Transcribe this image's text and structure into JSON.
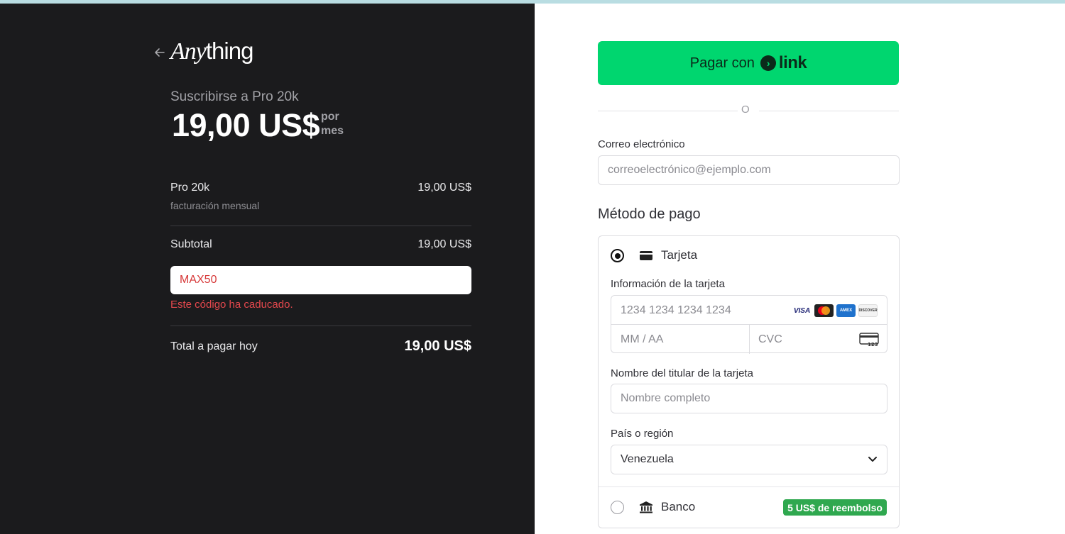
{
  "summary": {
    "brand_any": "Any",
    "brand_thing": "thing",
    "subscribe_title": "Suscribirse a Pro 20k",
    "price": "19,00 US$",
    "period_line1": "por",
    "period_line2": "mes",
    "item_name": "Pro 20k",
    "item_note": "facturación mensual",
    "item_price": "19,00 US$",
    "subtotal_label": "Subtotal",
    "subtotal_value": "19,00 US$",
    "coupon_value": "MAX50",
    "coupon_error": "Este código ha caducado.",
    "total_label": "Total a pagar hoy",
    "total_value": "19,00 US$"
  },
  "checkout": {
    "link_button_prefix": "Pagar con",
    "link_logo_text": "link",
    "or_text": "O",
    "email_label": "Correo electrónico",
    "email_placeholder": "correoelectrónico@ejemplo.com",
    "payment_method_title": "Método de pago",
    "card_option_label": "Tarjeta",
    "card_info_label": "Información de la tarjeta",
    "card_number_placeholder": "1234 1234 1234 1234",
    "expiry_placeholder": "MM / AA",
    "cvc_placeholder": "CVC",
    "card_brands": [
      "VISA",
      "MC",
      "AMEX",
      "DISCOVER"
    ],
    "cardholder_label": "Nombre del titular de la tarjeta",
    "cardholder_placeholder": "Nombre completo",
    "country_label": "País o región",
    "country_value": "Venezuela",
    "bank_option_label": "Banco",
    "bank_badge": "5 US$ de reembolso"
  },
  "colors": {
    "left_bg": "#1b1b1d",
    "link_green": "#00d66f",
    "error_red": "#e5484d",
    "bank_badge_green": "#2fa84f"
  }
}
